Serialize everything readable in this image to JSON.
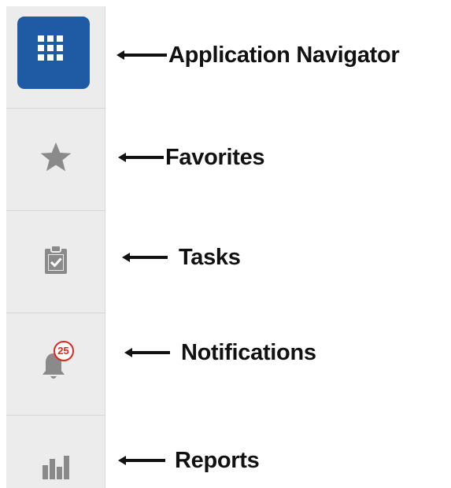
{
  "annotations": {
    "app_navigator": "Application Navigator",
    "favorites": "Favorites",
    "tasks": "Tasks",
    "notifications": "Notifications",
    "reports": "Reports"
  },
  "sidebar": {
    "items": [
      {
        "id": "app-navigator",
        "icon": "grid-icon"
      },
      {
        "id": "favorites",
        "icon": "star-icon"
      },
      {
        "id": "tasks",
        "icon": "clipboard-check-icon"
      },
      {
        "id": "notifications",
        "icon": "bell-icon"
      },
      {
        "id": "reports",
        "icon": "bar-chart-icon"
      }
    ]
  },
  "notifications": {
    "badge_count": "25"
  },
  "colors": {
    "nav_tile": "#1f5aa5",
    "icon_gray": "#8a8a8a",
    "badge_red": "#e0261d",
    "sidebar_bg": "#ececec"
  }
}
